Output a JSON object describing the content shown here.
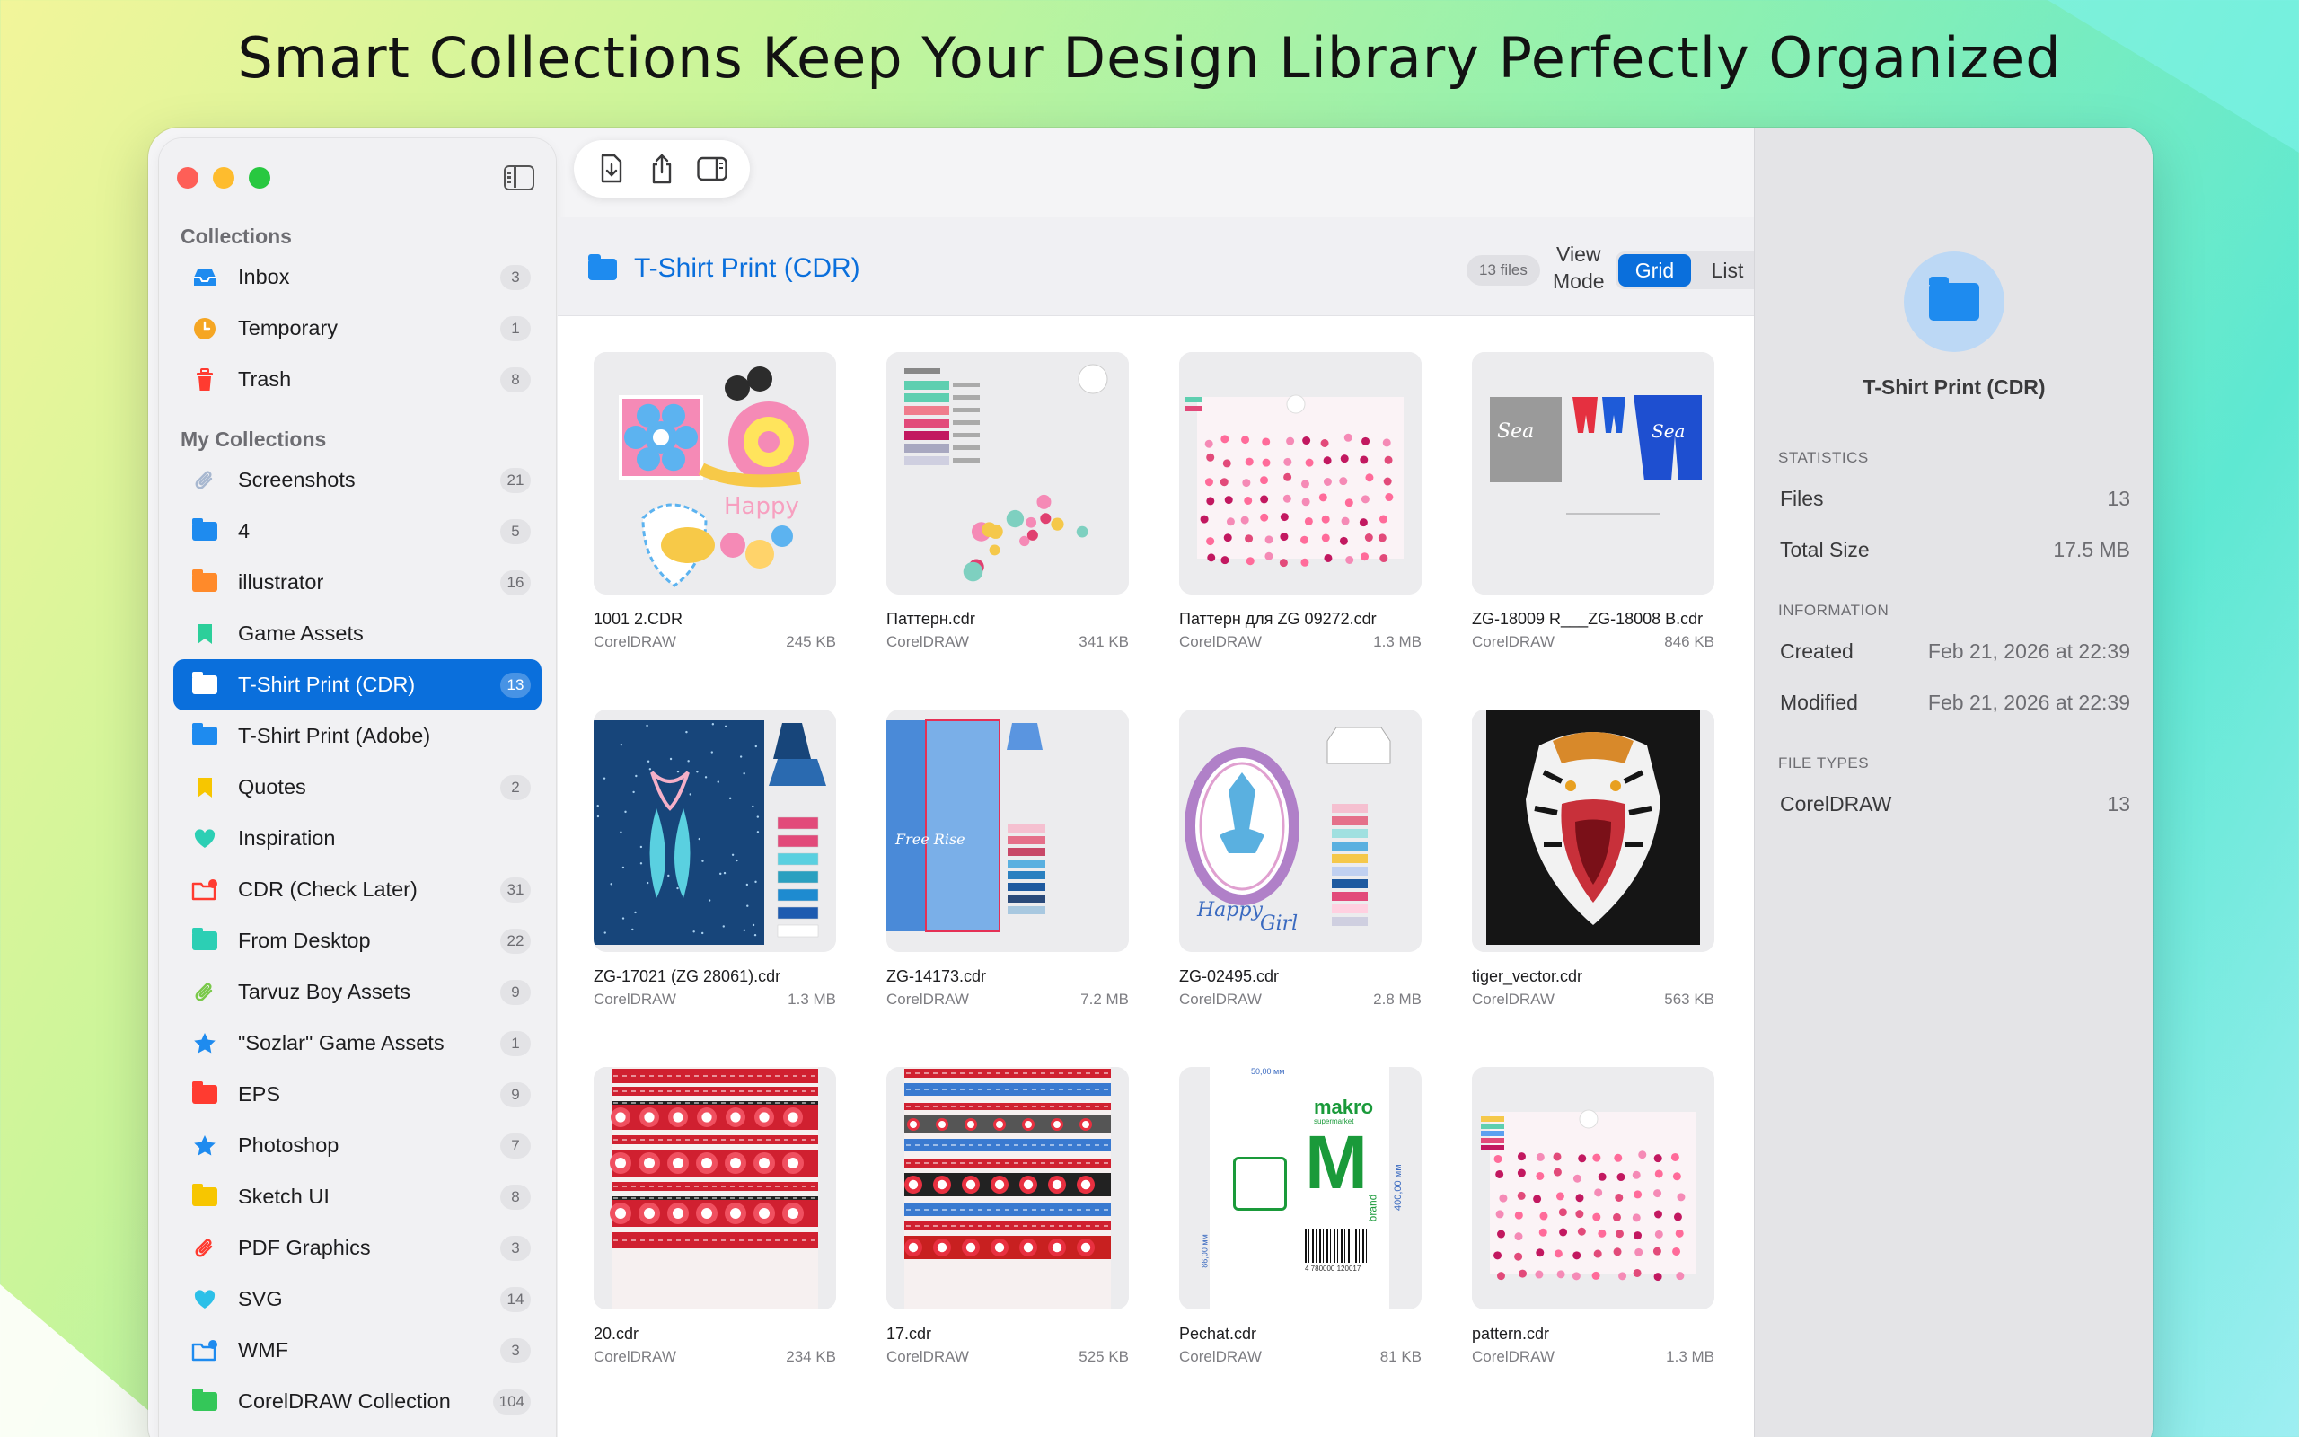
{
  "headline": "Smart Collections Keep Your Design Library Perfectly Organized",
  "sidebar": {
    "collections_title": "Collections",
    "collections": [
      {
        "label": "Inbox",
        "count": "3",
        "icon": "tray-icon",
        "color": "#1e8bef"
      },
      {
        "label": "Temporary",
        "count": "1",
        "icon": "clock-icon",
        "color": "#f5a623"
      },
      {
        "label": "Trash",
        "count": "8",
        "icon": "trash-icon",
        "color": "#ff3b30"
      }
    ],
    "my_collections_title": "My Collections",
    "my_collections": [
      {
        "label": "Screenshots",
        "count": "21",
        "icon": "paperclip-icon",
        "color": "#a8b8d0"
      },
      {
        "label": "4",
        "count": "5",
        "icon": "folder-icon",
        "color": "#1e8bef"
      },
      {
        "label": "illustrator",
        "count": "16",
        "icon": "folder-icon",
        "color": "#ff8a2a"
      },
      {
        "label": "Game Assets",
        "count": "",
        "icon": "bookmark-icon",
        "color": "#2ccf9a"
      },
      {
        "label": "T-Shirt Print (CDR)",
        "count": "13",
        "icon": "folder-icon",
        "color": "#1e8bef",
        "selected": true
      },
      {
        "label": "T-Shirt Print (Adobe)",
        "count": "",
        "icon": "folder-icon",
        "color": "#1e8bef"
      },
      {
        "label": "Quotes",
        "count": "2",
        "icon": "bookmark-icon",
        "color": "#f7c600"
      },
      {
        "label": "Inspiration",
        "count": "",
        "icon": "heart-icon",
        "color": "#2ccfb4"
      },
      {
        "label": "CDR (Check Later)",
        "count": "31",
        "icon": "folder-badge-icon",
        "color": "#ff3b30"
      },
      {
        "label": "From Desktop",
        "count": "22",
        "icon": "folder-icon",
        "color": "#2ccfb4"
      },
      {
        "label": "Tarvuz Boy Assets",
        "count": "9",
        "icon": "paperclip-icon",
        "color": "#7ac94a"
      },
      {
        "label": "\"Sozlar\" Game Assets",
        "count": "1",
        "icon": "star-icon",
        "color": "#1e8bef"
      },
      {
        "label": "EPS",
        "count": "9",
        "icon": "folder-icon",
        "color": "#ff3b30"
      },
      {
        "label": "Photoshop",
        "count": "7",
        "icon": "star-icon",
        "color": "#1e8bef"
      },
      {
        "label": "Sketch UI",
        "count": "8",
        "icon": "folder-icon",
        "color": "#f7c600"
      },
      {
        "label": "PDF Graphics",
        "count": "3",
        "icon": "paperclip-icon",
        "color": "#ff3b30"
      },
      {
        "label": "SVG",
        "count": "14",
        "icon": "heart-icon",
        "color": "#2cc0e8"
      },
      {
        "label": "WMF",
        "count": "3",
        "icon": "folder-badge-icon",
        "color": "#1e8bef"
      },
      {
        "label": "CorelDRAW Collection",
        "count": "104",
        "icon": "folder-icon",
        "color": "#34c759"
      }
    ]
  },
  "header": {
    "title": "T-Shirt Print (CDR)",
    "files_badge": "13 files",
    "view_mode_label": "View\nMode",
    "grid_label": "Grid",
    "list_label": "List"
  },
  "files": [
    {
      "name": "1001 2.CDR",
      "type": "CorelDRAW",
      "size": "245 KB",
      "thumb": "snail"
    },
    {
      "name": "Паттерн.cdr",
      "type": "CorelDRAW",
      "size": "341 KB",
      "thumb": "swatches"
    },
    {
      "name": "Паттерн для ZG 09272.cdr",
      "type": "CorelDRAW",
      "size": "1.3 MB",
      "thumb": "candy"
    },
    {
      "name": "ZG-18009 R___ZG-18008 B.cdr",
      "type": "CorelDRAW",
      "size": "846 KB",
      "thumb": "sea"
    },
    {
      "name": "ZG-17021 (ZG 28061).cdr",
      "type": "CorelDRAW",
      "size": "1.3 MB",
      "thumb": "ballet"
    },
    {
      "name": "ZG-14173.cdr",
      "type": "CorelDRAW",
      "size": "7.2 MB",
      "thumb": "lightblue"
    },
    {
      "name": "ZG-02495.cdr",
      "type": "CorelDRAW",
      "size": "2.8 MB",
      "thumb": "mirror"
    },
    {
      "name": "tiger_vector.cdr",
      "type": "CorelDRAW",
      "size": "563 KB",
      "thumb": "tiger"
    },
    {
      "name": "20.cdr",
      "type": "CorelDRAW",
      "size": "234 KB",
      "thumb": "embroidery_red"
    },
    {
      "name": "17.cdr",
      "type": "CorelDRAW",
      "size": "525 KB",
      "thumb": "embroidery_mixed"
    },
    {
      "name": "Pechat.cdr",
      "type": "CorelDRAW",
      "size": "81 KB",
      "thumb": "makro"
    },
    {
      "name": "pattern.cdr",
      "type": "CorelDRAW",
      "size": "1.3 MB",
      "thumb": "candy2"
    }
  ],
  "inspector": {
    "title": "T-Shirt Print (CDR)",
    "statistics_title": "STATISTICS",
    "files_label": "Files",
    "files_value": "13",
    "size_label": "Total Size",
    "size_value": "17.5 MB",
    "information_title": "INFORMATION",
    "created_label": "Created",
    "created_value": "Feb 21, 2026 at 22:39",
    "modified_label": "Modified",
    "modified_value": "Feb 21, 2026 at 22:39",
    "filetypes_title": "FILE TYPES",
    "filetype_label": "CorelDRAW",
    "filetype_value": "13"
  },
  "thumb_text": {
    "makro_brand": "makro",
    "makro_sub": "supermarket",
    "makro_letter": "M",
    "makro_side": "brand",
    "dim_top": "50,00 мм",
    "dim_right": "400,00 мм",
    "dim_left": "86,00 мм",
    "barcode_digits": "4 780000 120017"
  }
}
